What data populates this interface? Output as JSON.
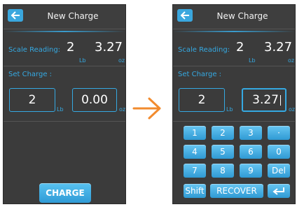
{
  "header": {
    "title": "New Charge"
  },
  "scale": {
    "label": "Scale Reading:",
    "lb_value": "2",
    "oz_value": "3.27",
    "lb_unit": "Lb",
    "oz_unit": "oz"
  },
  "set_charge": {
    "label": "Set Charge :"
  },
  "left": {
    "lb_field": "2",
    "oz_field": "0.00",
    "lb_unit": "Lb",
    "oz_unit": "oz"
  },
  "right": {
    "lb_field": "2",
    "oz_field": "3.27",
    "lb_unit": "Lb",
    "oz_unit": "oz"
  },
  "charge_button": "CHARGE",
  "keypad": {
    "row1": [
      "1",
      "2",
      "3",
      "·"
    ],
    "row2": [
      "4",
      "5",
      "6",
      "0"
    ],
    "row3": [
      "7",
      "8",
      "9",
      "Del"
    ],
    "row4": [
      "Shift",
      "RECOVER"
    ],
    "enter_icon": "enter-arrow-icon"
  },
  "colors": {
    "accent": "#35a9e2",
    "screen_bg": "#3b3b3b",
    "arrow": "#f28b2e"
  }
}
